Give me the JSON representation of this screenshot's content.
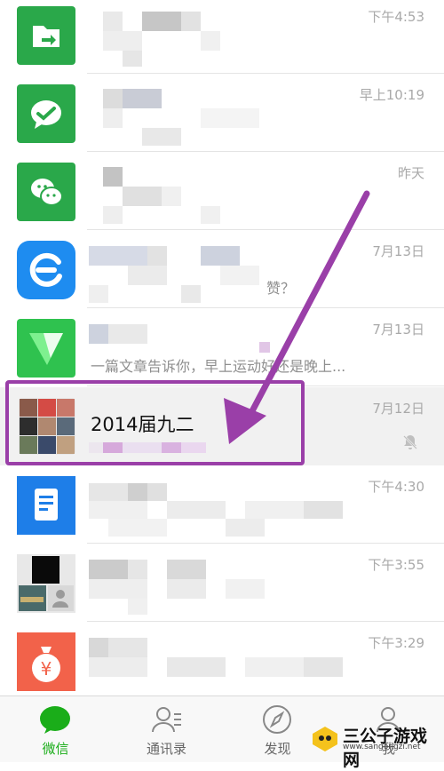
{
  "chats": [
    {
      "time": "下午4:53",
      "avatar_icon": "file-transfer-icon",
      "avatar_color": "#2aa84a"
    },
    {
      "time": "早上10:19",
      "avatar_icon": "wechat-pay-icon",
      "avatar_color": "#2aa84a"
    },
    {
      "time": "昨天",
      "avatar_icon": "wechat-team-icon",
      "avatar_color": "#2aa84a"
    },
    {
      "time": "7月13日",
      "avatar_icon": "e-app-icon",
      "avatar_color": "#1e8cf0",
      "preview_fragment": "赞？"
    },
    {
      "time": "7月13日",
      "avatar_icon": "green-v-icon",
      "avatar_color": "#2fc24f",
      "preview": "一篇文章告诉你，早上运动好还是晚上..."
    },
    {
      "time": "7月12日",
      "title": "2014届九二",
      "avatar_icon": "group-photo-icon",
      "muted": true
    },
    {
      "time": "下午4:30",
      "avatar_icon": "document-icon",
      "avatar_color": "#1e7ee8"
    },
    {
      "time": "下午3:55",
      "avatar_icon": "group-photo-icon"
    },
    {
      "time": "下午3:29",
      "avatar_icon": "money-bag-icon",
      "avatar_color": "#f2624a"
    }
  ],
  "tabs": [
    {
      "label": "微信",
      "icon": "chat-bubble-icon",
      "active": true
    },
    {
      "label": "通讯录",
      "icon": "contacts-icon",
      "active": false
    },
    {
      "label": "发现",
      "icon": "compass-icon",
      "active": false
    },
    {
      "label": "我",
      "icon": "me-icon",
      "active": false
    }
  ],
  "watermark": {
    "text": "三公子游戏网",
    "url": "www.sangongzi.net"
  },
  "colors": {
    "accent": "#1aad19",
    "annotation": "#9a3fa8"
  }
}
